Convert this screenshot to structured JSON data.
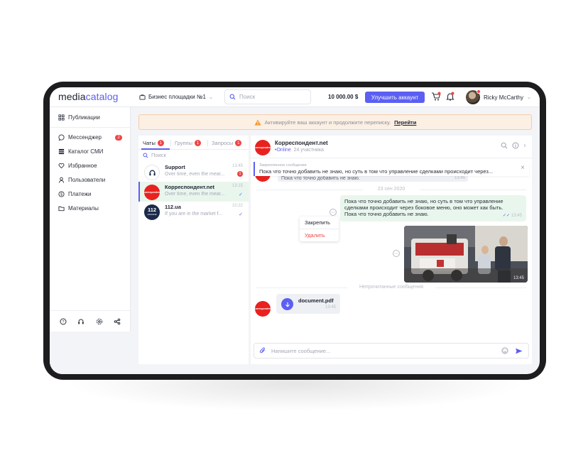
{
  "app": {
    "logo_part1": "media",
    "logo_part2": "catalog"
  },
  "topbar": {
    "workspace": "Бизнес площадки №1",
    "search_placeholder": "Поиск",
    "balance": "10 000.00 $",
    "upgrade_label": "Улучшить аккаунт",
    "user_name": "Ricky McCarthy"
  },
  "sidebar": {
    "items": [
      {
        "label": "Публикации",
        "icon": "grid-icon"
      },
      {
        "label": "Мессенджер",
        "icon": "chat-icon",
        "badge": "2"
      },
      {
        "label": "Каталог СМИ",
        "icon": "catalog-icon"
      },
      {
        "label": "Избранное",
        "icon": "heart-icon"
      },
      {
        "label": "Пользователи",
        "icon": "user-icon"
      },
      {
        "label": "Платежи",
        "icon": "dollar-icon"
      },
      {
        "label": "Материалы",
        "icon": "folder-icon"
      }
    ],
    "bottom_icons": [
      "help-icon",
      "headset-icon",
      "settings-icon",
      "share-icon"
    ]
  },
  "alert": {
    "text": "Активируйте ваш аккаунт и продолжите переписку.",
    "link": "Перейти"
  },
  "chatlist": {
    "tabs": [
      {
        "label": "Чаты",
        "badge": "1",
        "active": true
      },
      {
        "label": "Группы",
        "badge": "1",
        "active": false
      },
      {
        "label": "Запросы",
        "badge": "1",
        "active": false
      }
    ],
    "search_placeholder": "Поиск",
    "chats": [
      {
        "name": "Support",
        "preview": "Over time, even the mear...",
        "time": "13:45",
        "badge": "1",
        "active": false
      },
      {
        "name": "Корреспондент.net",
        "preview": "Over time, even the mear...",
        "time": "13:15",
        "active": true
      },
      {
        "name": "112.ua",
        "preview": "If you are in the market f...",
        "time": "10:22",
        "active": false
      }
    ]
  },
  "chat": {
    "name": "Корреспондент.net",
    "status_online": "•Online",
    "participants": "24 участника",
    "pinned_label": "Закрепленное сообщение",
    "pinned_text": "Пока что точно добавить не знаю, но суть в том что управление сделками происходит через...",
    "under_msg_text": "Пока что точно добавить не знаю.",
    "under_msg_time": "13:45",
    "date_separator": "23 сен 2020",
    "out_message": {
      "lines": [
        "Пока что точно добавить не знаю, но суть в том что управление",
        "сделками происходит через боковое меню, оно может как быть.",
        "Пока что точно добавить не знаю."
      ],
      "time": "13:45"
    },
    "context_menu": {
      "pin": "Закрепить",
      "delete": "Удалить"
    },
    "photo_time": "13:45",
    "unread_separator": "Непрочитанные сообщения",
    "file_message": {
      "name": "document.pdf",
      "time": "13:45"
    },
    "composer_placeholder": "Напишите сообщение..."
  },
  "colors": {
    "accent": "#5b5ff2",
    "badge": "#f04444",
    "outgoing_bg": "#e9f6ed",
    "alert_bg": "#fcefe3",
    "korrespondent_red": "#e8221f"
  }
}
